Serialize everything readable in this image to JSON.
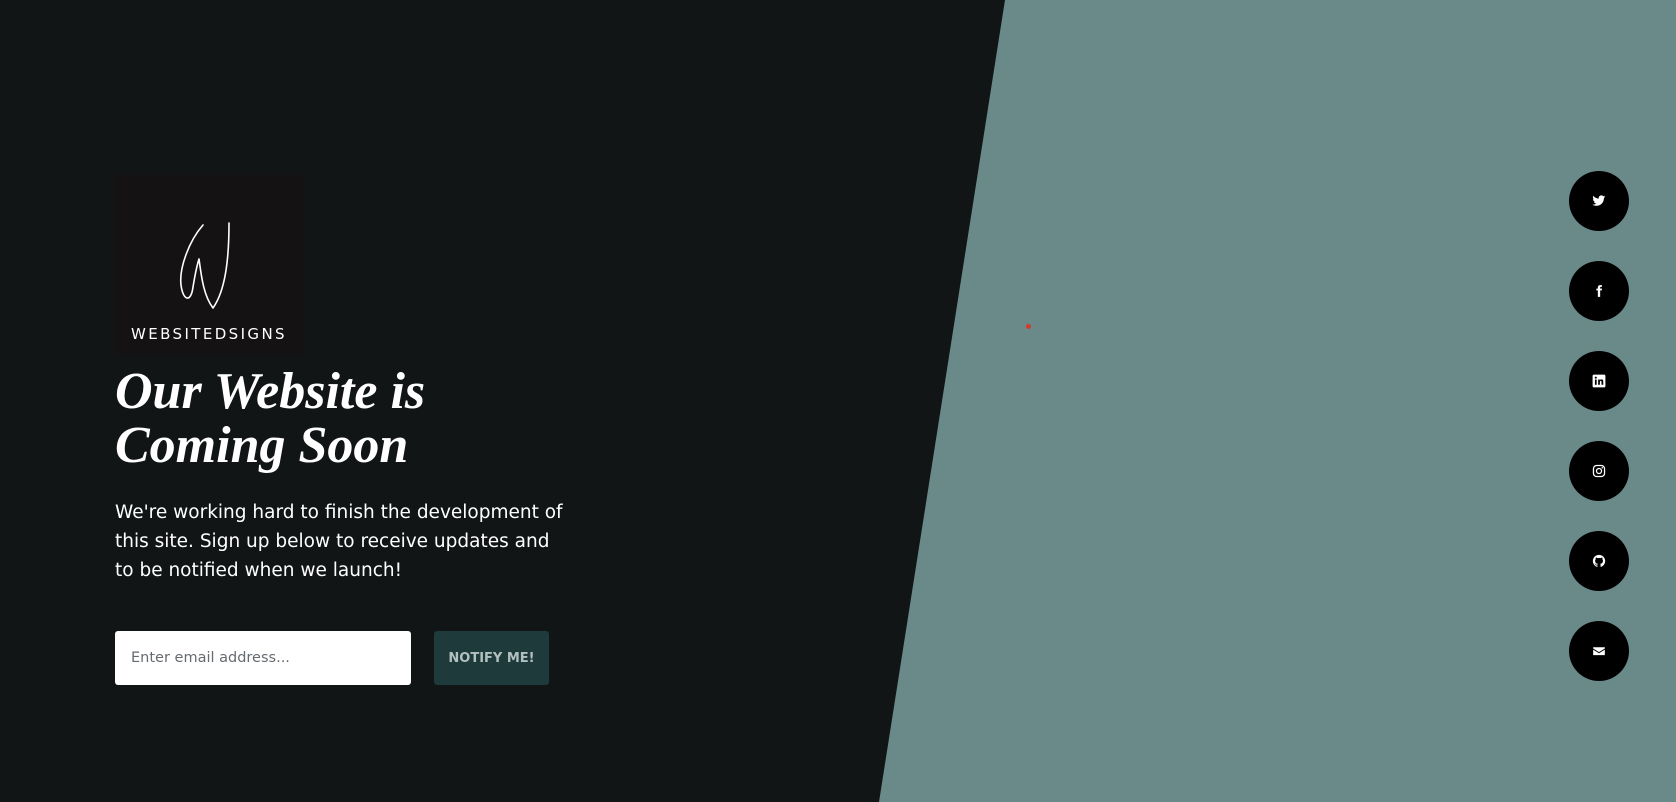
{
  "brand": {
    "logo_text": "WEBSITEDSIGNS"
  },
  "hero": {
    "headline_line1": "Our Website is",
    "headline_line2": "Coming Soon",
    "description": "We're working hard to finish the development of this site. Sign up below to receive updates and to be notified when we launch!"
  },
  "signup": {
    "email_placeholder": "Enter email address...",
    "email_value": "",
    "button_label": "NOTIFY ME!"
  },
  "social": [
    {
      "icon": "twitter-icon"
    },
    {
      "icon": "facebook-icon"
    },
    {
      "icon": "linkedin-icon"
    },
    {
      "icon": "instagram-icon"
    },
    {
      "icon": "github-icon"
    },
    {
      "icon": "envelope-icon"
    }
  ],
  "colors": {
    "left_background": "#111516",
    "right_background": "#6a8a89",
    "button_background": "#1e3a3b",
    "social_button": "#000000"
  }
}
